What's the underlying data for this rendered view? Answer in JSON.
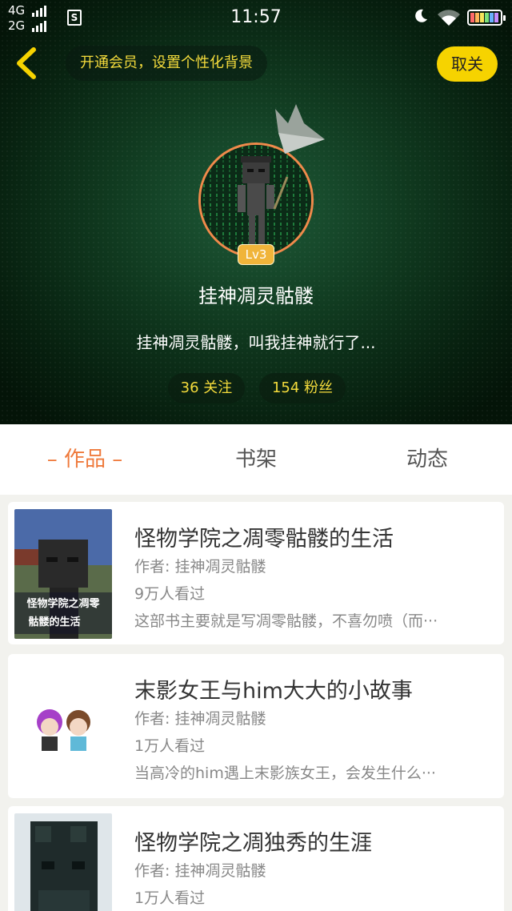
{
  "status_bar": {
    "network1": "4G",
    "network2": "2G",
    "sim_icon": "S",
    "time": "11:57",
    "icons": [
      "moon-icon",
      "wifi-icon",
      "battery-icon"
    ]
  },
  "header": {
    "vip_prompt": "开通会员，设置个性化背景",
    "unfollow_label": "取关",
    "level_badge": "Lv3",
    "username": "挂神凋灵骷髅",
    "signature": "挂神凋灵骷髅，叫我挂神就行了...",
    "following": "36 关注",
    "fans": "154 粉丝",
    "accent_color": "#f6d300"
  },
  "tabs": [
    {
      "label": "– 作品 –",
      "active": true
    },
    {
      "label": "书架",
      "active": false
    },
    {
      "label": "动态",
      "active": false
    }
  ],
  "books": [
    {
      "title": "怪物学院之凋零骷髅的生活",
      "author": "作者: 挂神凋灵骷髅",
      "views": "9万人看过",
      "desc": "这部书主要就是写凋零骷髅，不喜勿喷（而···",
      "cover_text_1": "怪物学院之凋零",
      "cover_text_2": "骷髅的生活"
    },
    {
      "title": "末影女王与him大大的小故事",
      "author": "作者: 挂神凋灵骷髅",
      "views": "1万人看过",
      "desc": "当高冷的him遇上末影族女王，会发生什么···"
    },
    {
      "title": "怪物学院之凋独秀的生涯",
      "author": "作者: 挂神凋灵骷髅",
      "views": "1万人看过",
      "desc": ""
    }
  ]
}
